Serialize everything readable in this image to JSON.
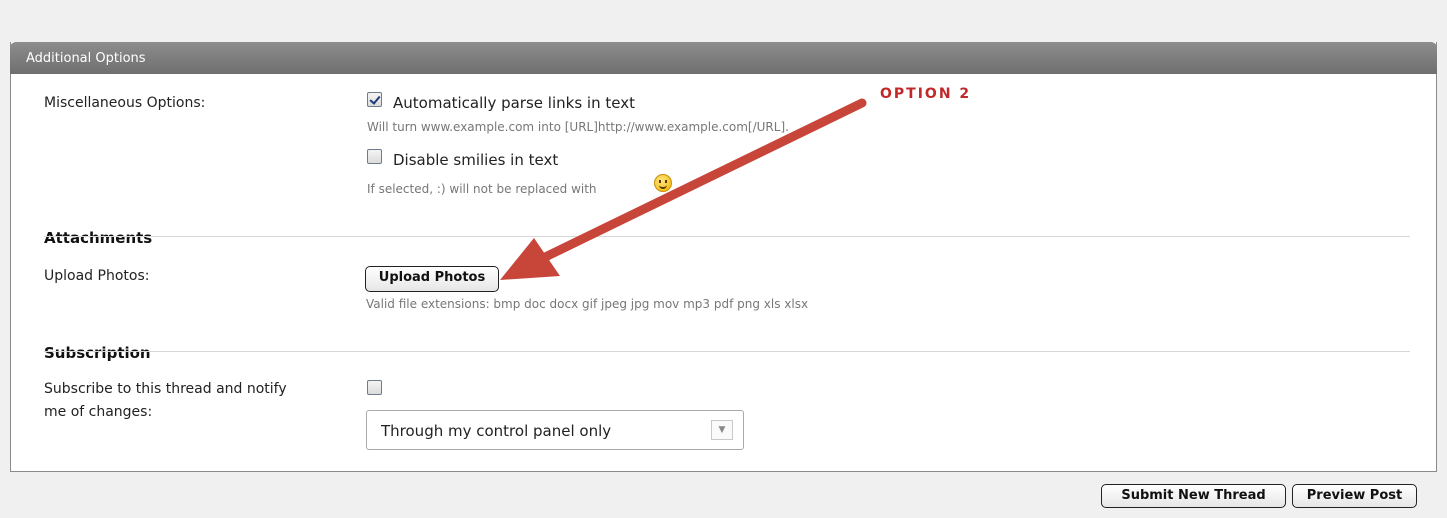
{
  "panel": {
    "title": "Additional Options"
  },
  "misc": {
    "label": "Miscellaneous Options:",
    "parse_links": {
      "label": "Automatically parse links in text",
      "checked": true,
      "description": "Will turn www.example.com into [URL]http://www.example.com[/URL]."
    },
    "disable_smilies": {
      "label": "Disable smilies in text",
      "checked": false,
      "description": "If selected, :) will not be replaced with",
      "icon": "smiley-icon"
    }
  },
  "attachments": {
    "section_title": "Attachments",
    "label": "Upload Photos:",
    "button_label": "Upload Photos",
    "extensions": "Valid file extensions: bmp doc docx gif jpeg jpg mov mp3 pdf png xls xlsx"
  },
  "subscription": {
    "section_title": "Subscription",
    "label_line1": "Subscribe to this thread and notify",
    "label_line2": "me of changes:",
    "checked": false,
    "mode_selected": "Through my control panel only"
  },
  "annotation": {
    "text": "OPTION 2",
    "color": "#c0282a"
  },
  "footer": {
    "submit_label": "Submit New Thread",
    "preview_label": "Preview Post"
  }
}
